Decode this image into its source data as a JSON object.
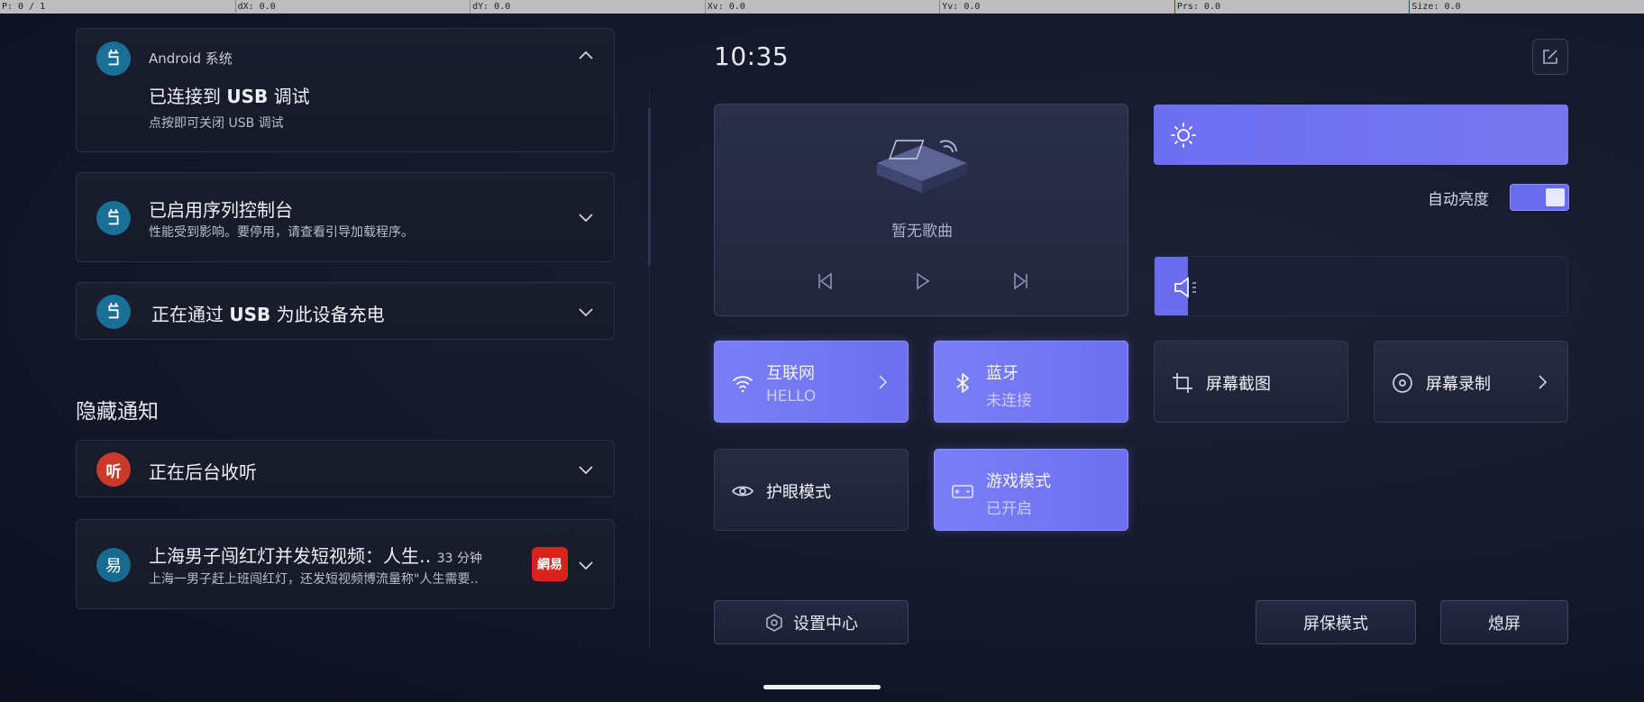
{
  "debug": {
    "cells": [
      "P: 0 / 1",
      "dX: 0.0",
      "dY: 0.0",
      "Xv: 0.0",
      "Yv: 0.0",
      "Prs: 0.0",
      "Size: 0.0"
    ]
  },
  "notifications": [
    {
      "app": "Android 系统",
      "title_pre": "已连接到 ",
      "title_bold": "USB",
      "title_post": " 调试",
      "subtitle": "点按即可关闭 USB 调试",
      "expanded": true
    },
    {
      "title": "已启用序列控制台",
      "subtitle": "性能受到影响。要停用，请查看引导加载程序。"
    },
    {
      "title_pre": "正在通过 ",
      "title_bold": "USB",
      "title_post": " 为此设备充电"
    }
  ],
  "hidden": {
    "header": "隐藏通知",
    "items": [
      {
        "title": "正在后台收听",
        "icon_text": "听"
      },
      {
        "title": "上海男子闯红灯并发短视频：人生‥",
        "time": "33 分钟",
        "subtitle": "上海一男子赶上班闯红灯，还发短视频博流量称\"人生需要‥",
        "icon_text": "易",
        "badge_text": "網易"
      }
    ]
  },
  "quick": {
    "clock": "10:35",
    "media": {
      "no_song": "暂无歌曲"
    },
    "brightness_level": 1.0,
    "auto_brightness_label": "自动亮度",
    "auto_brightness_on": true,
    "volume_level": 0.08,
    "tiles": [
      {
        "label": "互联网",
        "sub": "HELLO",
        "active": true,
        "icon": "wifi-icon"
      },
      {
        "label": "蓝牙",
        "sub": "未连接",
        "active": true,
        "icon": "bluetooth-icon"
      },
      {
        "label": "屏幕截图",
        "active": false,
        "icon": "crop-icon"
      },
      {
        "label": "屏幕录制",
        "active": false,
        "icon": "record-icon"
      },
      {
        "label": "护眼模式",
        "active": false,
        "icon": "eye-icon"
      },
      {
        "label": "游戏模式",
        "sub": "已开启",
        "active": true,
        "icon": "gamepad-icon"
      }
    ],
    "settings_label": "设置中心",
    "screensaver_label": "屏保模式",
    "screen_off_label": "熄屏"
  },
  "colors": {
    "accent": "#6d6ef2",
    "app_icon": "#1a6f97"
  }
}
